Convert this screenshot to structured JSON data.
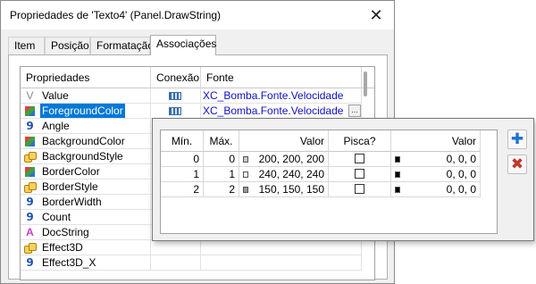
{
  "window": {
    "title": "Propriedades de 'Texto4' (Panel.DrawString)",
    "close_glyph": "✕"
  },
  "tabs": [
    {
      "label": "Item"
    },
    {
      "label": "Posição"
    },
    {
      "label": "Formatação"
    },
    {
      "label": "Associações",
      "active": true
    }
  ],
  "grid": {
    "headers": {
      "property": "Propriedades",
      "connection": "Conexão",
      "source": "Fonte"
    },
    "rows": [
      {
        "icon": "value-icon",
        "name": "Value",
        "connected": true,
        "source": "XC_Bomba.Fonte.Velocidade"
      },
      {
        "icon": "color-icon",
        "name": "ForegroundColor",
        "connected": true,
        "source": "XC_Bomba.Fonte.Velocidade",
        "selected": true,
        "has_ellipsis": true
      },
      {
        "icon": "number-icon",
        "name": "Angle"
      },
      {
        "icon": "color-icon",
        "name": "BackgroundColor"
      },
      {
        "icon": "enum-icon",
        "name": "BackgroundStyle"
      },
      {
        "icon": "color-icon",
        "name": "BorderColor"
      },
      {
        "icon": "enum-icon",
        "name": "BorderStyle"
      },
      {
        "icon": "number-icon",
        "name": "BorderWidth"
      },
      {
        "icon": "number-icon",
        "name": "Count"
      },
      {
        "icon": "string-icon",
        "name": "DocString"
      },
      {
        "icon": "enum-icon",
        "name": "Effect3D"
      },
      {
        "icon": "number-icon",
        "name": "Effect3D_X"
      }
    ],
    "icon_glyphs": {
      "value-icon": "V",
      "number-icon": "9",
      "string-icon": "A"
    },
    "ellipsis_label": "..."
  },
  "popup": {
    "headers": {
      "min": "Mín.",
      "max": "Máx.",
      "value": "Valor",
      "blink": "Pisca?",
      "blink_value": "Valor"
    },
    "rows": [
      {
        "min": "0",
        "max": "0",
        "value": "200, 200, 200",
        "value_color": "#c8c8c8",
        "blink": false,
        "blink_value": "0, 0, 0",
        "blink_color": "#000000"
      },
      {
        "min": "1",
        "max": "1",
        "value": "240, 240, 240",
        "value_color": "#f0f0f0",
        "blink": false,
        "blink_value": "0, 0, 0",
        "blink_color": "#000000"
      },
      {
        "min": "2",
        "max": "2",
        "value": "150, 150, 150",
        "value_color": "#969696",
        "blink": false,
        "blink_value": "0, 0, 0",
        "blink_color": "#000000"
      }
    ],
    "add_glyph": "✚",
    "remove_glyph": "✖",
    "add_color": "#1e6fd0",
    "remove_color": "#c0392b"
  },
  "colors": {
    "selection": "#0078d7",
    "link_text": "#1010c0"
  }
}
